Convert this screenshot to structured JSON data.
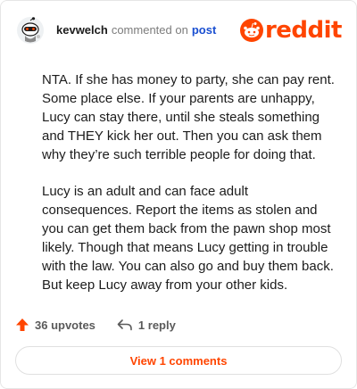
{
  "comment": {
    "username": "kevwelch",
    "action_text": "commented on",
    "post_link": "post",
    "paragraphs": [
      "NTA. If she has money to party, she can pay rent. Some place else. If your parents are unhappy, Lucy can stay there, until she steals something and THEY kick her out. Then you can ask them why they’re such terrible people for doing that.",
      "Lucy is an adult and can face adult consequences. Report the items as stolen and you can get them back from the pawn shop most likely. Though that means Lucy getting in trouble with the law. You can also go and buy them back. But keep Lucy away from your other kids."
    ]
  },
  "brand": {
    "name": "reddit",
    "color": "#ff4500"
  },
  "footer": {
    "upvotes_label": "36 upvotes",
    "reply_label": "1 reply",
    "view_comments_label": "View 1 comments"
  },
  "icons": {
    "avatar": "snoo-avatar-icon",
    "upvote": "upvote-arrow-icon",
    "reply": "reply-arrow-icon",
    "logo": "reddit-snoo-icon"
  }
}
